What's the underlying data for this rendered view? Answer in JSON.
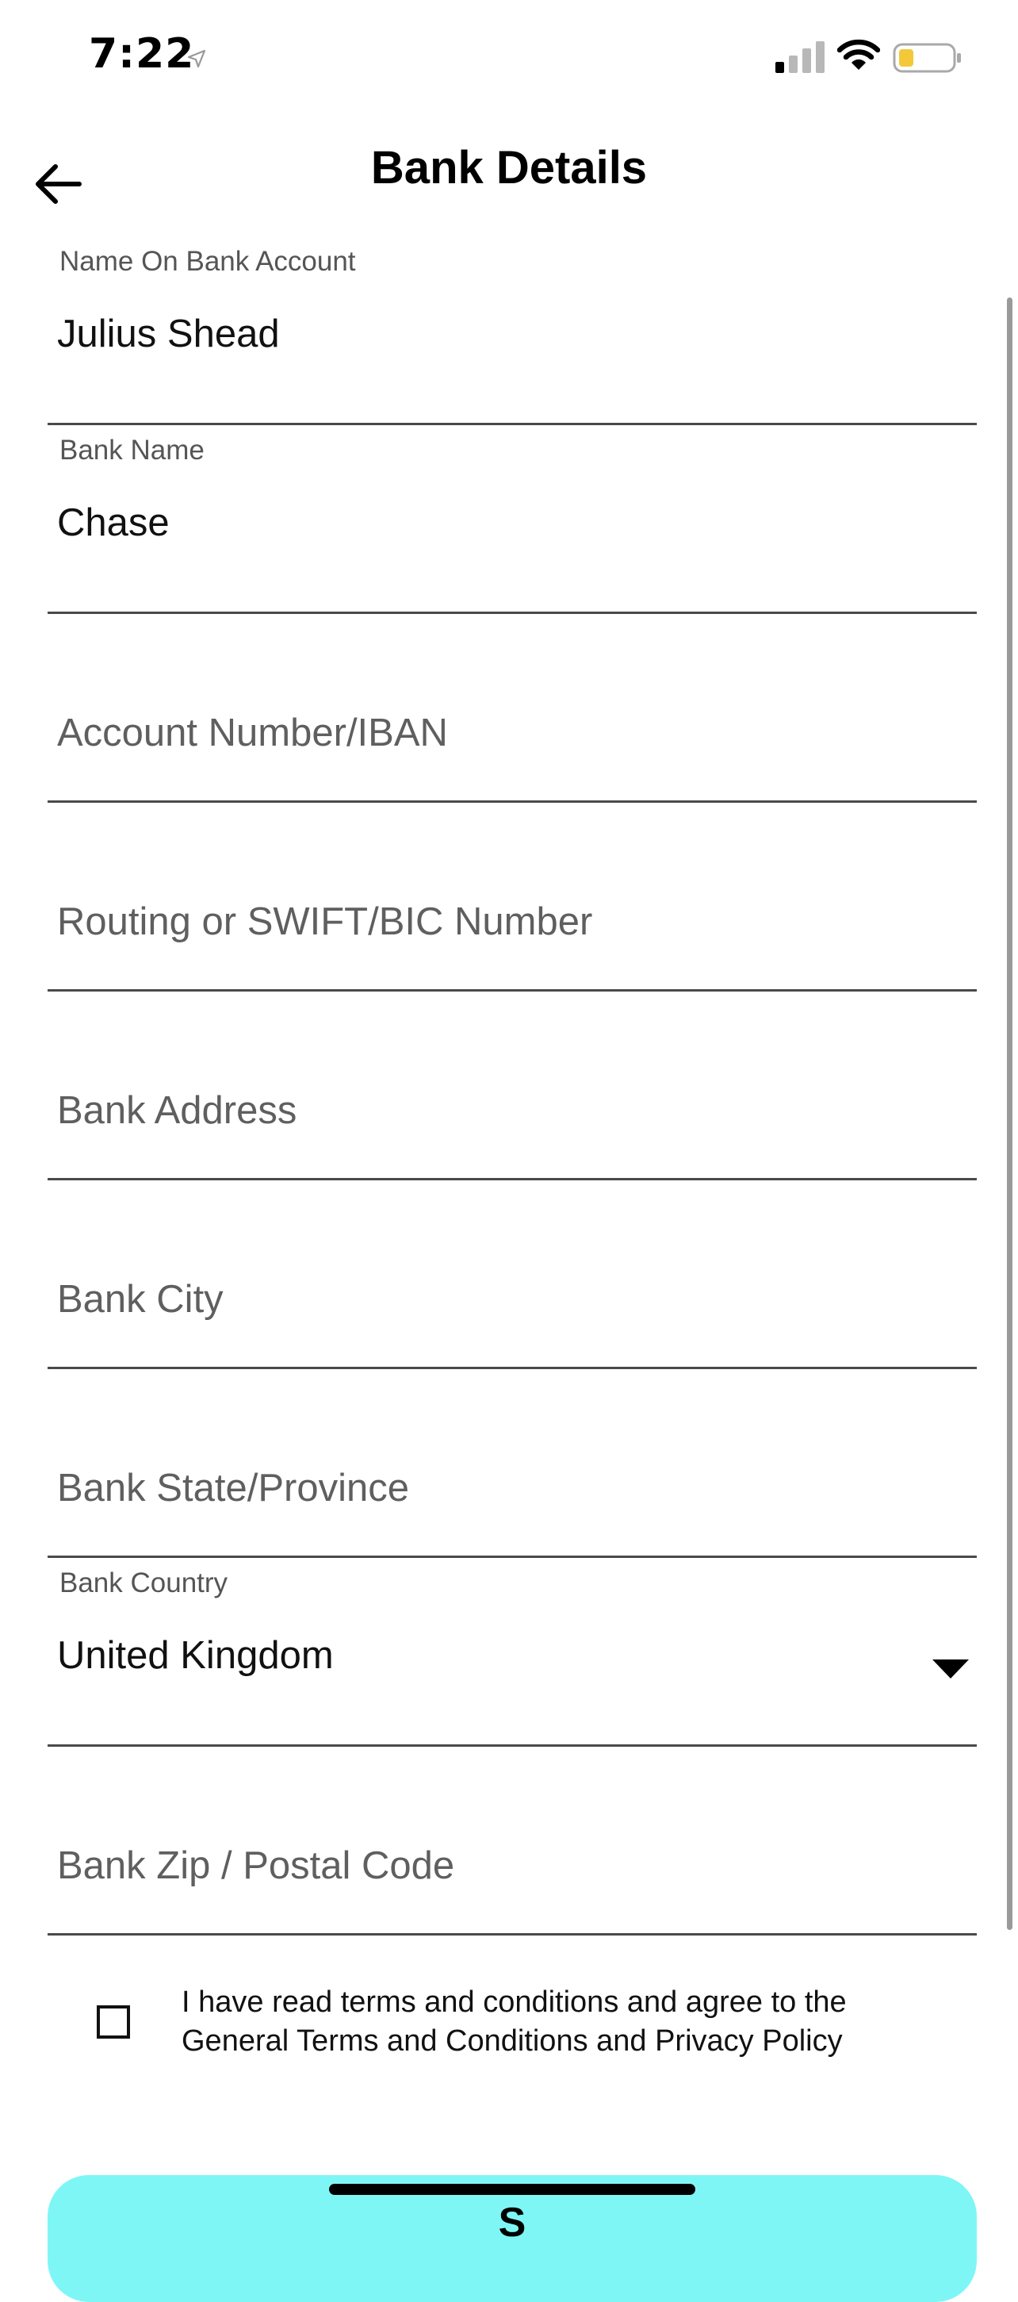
{
  "status_bar": {
    "time": "7:22",
    "icons": {
      "location": "location-arrow-icon",
      "signal": "cellular-signal-icon",
      "wifi": "wifi-icon",
      "battery": "battery-low-icon"
    },
    "battery_color": "#f3c93a"
  },
  "header": {
    "title": "Bank Details",
    "back_icon": "arrow-left-icon"
  },
  "form": {
    "name_on_account": {
      "label": "Name On Bank Account",
      "value": "Julius Shead"
    },
    "bank_name": {
      "label": "Bank Name",
      "value": "Chase"
    },
    "account_number": {
      "placeholder": "Account Number/IBAN"
    },
    "routing_number": {
      "placeholder": "Routing or SWIFT/BIC Number"
    },
    "bank_address": {
      "placeholder": "Bank Address"
    },
    "bank_city": {
      "placeholder": "Bank City"
    },
    "bank_state": {
      "placeholder": "Bank State/Province"
    },
    "bank_country": {
      "label": "Bank Country",
      "value": "United Kingdom",
      "caret_icon": "caret-down-icon"
    },
    "bank_zip": {
      "placeholder": "Bank Zip / Postal Code"
    }
  },
  "terms": {
    "checked": false,
    "line1": "I have read terms and conditions and agree to the",
    "line2": "General Terms and Conditions and Privacy Policy"
  },
  "submit": {
    "label": "S",
    "color": "#7ff6f6"
  }
}
